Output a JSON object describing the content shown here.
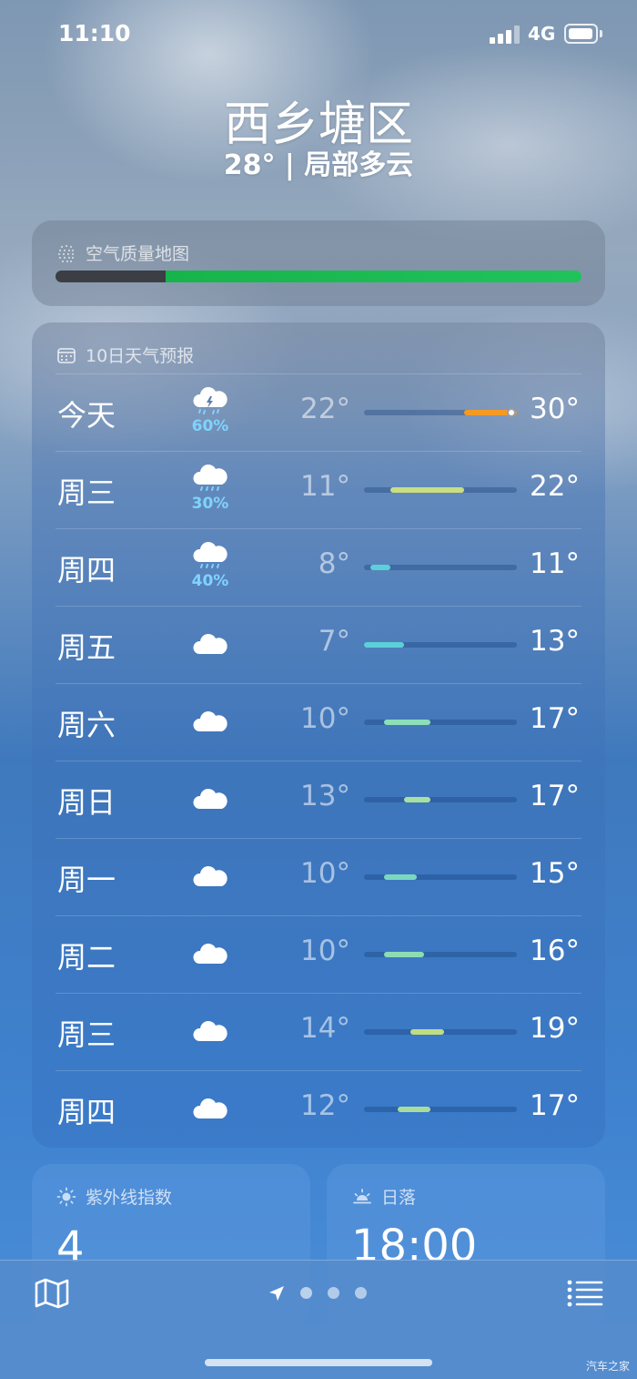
{
  "status_bar": {
    "time": "11:10",
    "network": "4G"
  },
  "header": {
    "location": "西乡塘区",
    "summary": "28° | 局部多云"
  },
  "air_quality": {
    "title": "空气质量地图",
    "level": 0.21
  },
  "forecast": {
    "title": "10日天气预报",
    "days": [
      {
        "day": "今天",
        "icon": "thunderstorm-icon",
        "precip": "60%",
        "low": "22°",
        "high": "30°",
        "color": "#f59a23",
        "current": 0.9
      },
      {
        "day": "周三",
        "icon": "rain-icon",
        "precip": "30%",
        "low": "11°",
        "high": "22°",
        "color": "#c8de80"
      },
      {
        "day": "周四",
        "icon": "rain-icon",
        "precip": "40%",
        "low": "8°",
        "high": "11°",
        "color": "#5bd0d8"
      },
      {
        "day": "周五",
        "icon": "cloud-icon",
        "precip": "",
        "low": "7°",
        "high": "13°",
        "color": "#5bd0d8"
      },
      {
        "day": "周六",
        "icon": "cloud-icon",
        "precip": "",
        "low": "10°",
        "high": "17°",
        "color": "#8cdfb8"
      },
      {
        "day": "周日",
        "icon": "cloud-icon",
        "precip": "",
        "low": "13°",
        "high": "17°",
        "color": "#a8e0a0"
      },
      {
        "day": "周一",
        "icon": "cloud-icon",
        "precip": "",
        "low": "10°",
        "high": "15°",
        "color": "#7ad8c0"
      },
      {
        "day": "周二",
        "icon": "cloud-icon",
        "precip": "",
        "low": "10°",
        "high": "16°",
        "color": "#8cdcb4"
      },
      {
        "day": "周三",
        "icon": "cloud-icon",
        "precip": "",
        "low": "14°",
        "high": "19°",
        "color": "#c2dc82"
      },
      {
        "day": "周四",
        "icon": "cloud-icon",
        "precip": "",
        "low": "12°",
        "high": "17°",
        "color": "#a8dc9c"
      }
    ]
  },
  "uv": {
    "title": "紫外线指数",
    "value": "4"
  },
  "sunset": {
    "title": "日落",
    "value": "18:00"
  },
  "toolbar": {
    "pages": 3,
    "active_page": 0
  },
  "watermark": "汽车之家"
}
